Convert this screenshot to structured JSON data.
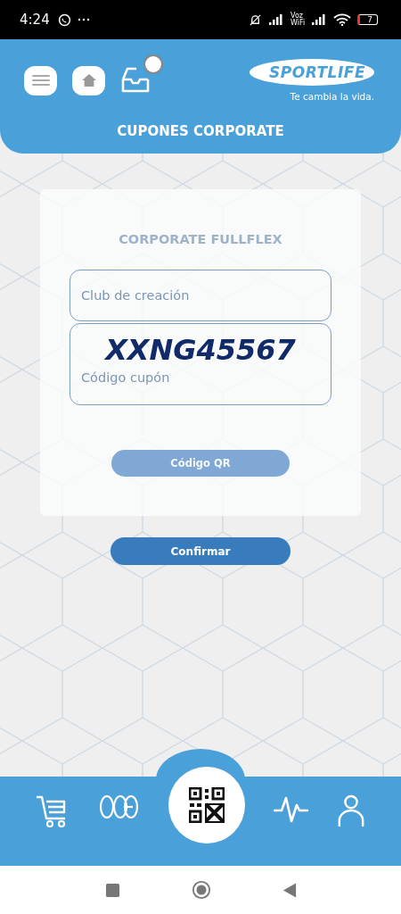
{
  "status_bar": {
    "time": "4:24",
    "network_label": [
      "Voz",
      "WiFi"
    ],
    "battery": "7"
  },
  "header": {
    "logo": "SPORTLIFE",
    "tagline": "Te cambia la vida.",
    "title": "CUPONES CORPORATE",
    "inbox_badge": true
  },
  "card": {
    "title": "CORPORATE FULLFLEX",
    "fields": [
      {
        "kind": "placeholder",
        "placeholder": "Club de creación"
      },
      {
        "kind": "code",
        "value": "XXNG45567",
        "label": "Código cupón"
      }
    ],
    "qr_button": "Código QR"
  },
  "confirm_button": "Confirmar"
}
